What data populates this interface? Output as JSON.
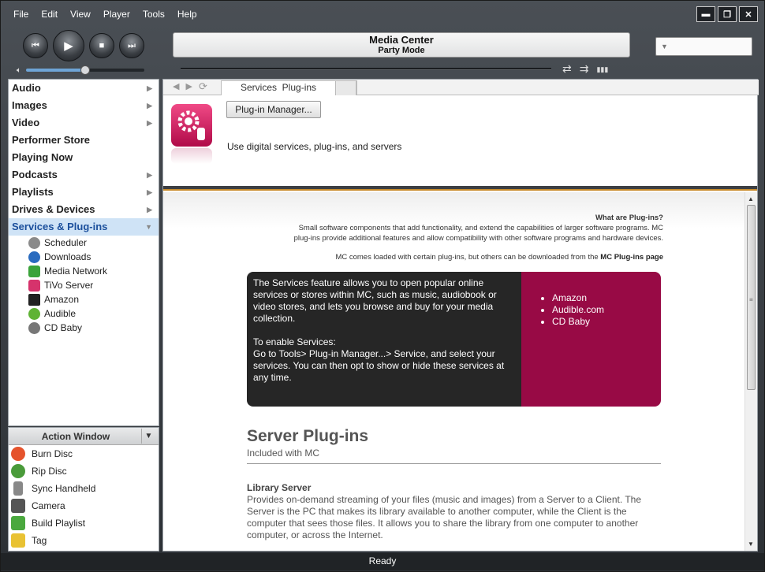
{
  "menubar": [
    "File",
    "Edit",
    "View",
    "Player",
    "Tools",
    "Help"
  ],
  "window_buttons": {
    "minimize": "▬",
    "maximize": "❐",
    "close": "✕"
  },
  "transport": {
    "prev": "⏮",
    "play": "▶",
    "stop": "■",
    "next": "⏭"
  },
  "volume": {
    "level": 0.5
  },
  "display": {
    "line1": "Media Center",
    "line2": "Party Mode"
  },
  "playmodes": {
    "repeat": "⇄",
    "shuffle": "⇉",
    "eq": "▮▮▮"
  },
  "search": {
    "placeholder": ""
  },
  "sidebar": {
    "items": [
      {
        "label": "Audio",
        "chevron": "▶"
      },
      {
        "label": "Images",
        "chevron": "▶"
      },
      {
        "label": "Video",
        "chevron": "▶"
      },
      {
        "label": "Performer Store",
        "chevron": ""
      },
      {
        "label": "Playing Now",
        "chevron": ""
      },
      {
        "label": "Podcasts",
        "chevron": "▶"
      },
      {
        "label": "Playlists",
        "chevron": "▶"
      },
      {
        "label": "Drives & Devices",
        "chevron": "▶"
      },
      {
        "label": "Services & Plug-ins",
        "chevron": "▼"
      }
    ],
    "subitems": [
      {
        "label": "Scheduler",
        "color": "#8a8a8a"
      },
      {
        "label": "Downloads",
        "color": "#2a6bbf"
      },
      {
        "label": "Media Network",
        "color": "#3aa33a"
      },
      {
        "label": "TiVo Server",
        "color": "#d6336c"
      },
      {
        "label": "Amazon",
        "color": "#222222"
      },
      {
        "label": "Audible",
        "color": "#5fb334"
      },
      {
        "label": "CD Baby",
        "color": "#777777"
      }
    ]
  },
  "action_window": {
    "title": "Action Window",
    "chevron": "▼",
    "items": [
      {
        "label": "Burn Disc",
        "color": "#e5532c"
      },
      {
        "label": "Rip Disc",
        "color": "#4a9b3a"
      },
      {
        "label": "Sync Handheld",
        "color": "#888888"
      },
      {
        "label": "Camera",
        "color": "#555555"
      },
      {
        "label": "Build Playlist",
        "color": "#4aa83e"
      },
      {
        "label": "Tag",
        "color": "#e9c233"
      }
    ]
  },
  "tabbar": {
    "back": "◀",
    "forward": "▶",
    "refresh": "⟳",
    "tab_label": "Services  Plug-ins"
  },
  "header": {
    "button": "Plug-in Manager...",
    "description": "Use digital services, plug-ins, and servers"
  },
  "content": {
    "whatare_heading": "What are Plug-ins?",
    "whatare_line1": "Small software components that add functionality, and extend the capabilities of larger software programs. MC",
    "whatare_line2": "plug-ins provide additional features and allow compatibility with other software programs and hardware devices.",
    "comes_text": "MC comes loaded with certain plug-ins, but others can be downloaded from the ",
    "comes_link": "MC Plug-ins page",
    "services_p1": "The Services feature allows you to open popular online services or stores within MC, such as music, audiobook or video stores, and lets you browse and buy for your media collection.",
    "services_p2_line1": "To enable Services:",
    "services_p2_line2": "Go to Tools> Plug-in Manager...> Service, and select your services. You can then opt to show or hide these services at any time.",
    "services_list": [
      "Amazon",
      "Audible.com",
      "CD Baby"
    ],
    "server_title": "Server Plug-ins",
    "server_sub": "Included with MC",
    "lib_title": "Library Server",
    "lib_desc": "Provides on-demand streaming of your files (music and images) from a Server to a Client. The Server is the PC that makes its library available to another computer, while the Client is the computer that sees those files. It allows you to share the library from one computer to another computer, or across the Internet."
  },
  "status": "Ready",
  "colors": {
    "accent": "#980a45",
    "selection": "#cfe3f6",
    "panel_dark": "#262626"
  }
}
